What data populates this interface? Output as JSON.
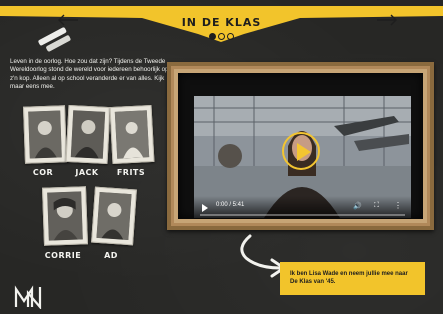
{
  "header": {
    "title": "IN DE KLAS",
    "page_indicator": {
      "total": 3,
      "current": 1
    }
  },
  "intro": {
    "text": "Leven in de oorlog. Hoe zou dat zijn? Tijdens de Tweede Wereldoorlog stond de wereld voor iedereen behoorlijk op z'n kop. Alleen al op school veranderde er van alles. Kijk maar eens mee."
  },
  "people": [
    {
      "name": "COR"
    },
    {
      "name": "JACK"
    },
    {
      "name": "FRITS"
    },
    {
      "name": "CORRIE"
    },
    {
      "name": "AD"
    }
  ],
  "video": {
    "time": "0:00 / 5:41",
    "progress": 0
  },
  "callout": {
    "text": "Ik ben Lisa Wade en neem jullie mee naar De Klas van '45."
  },
  "colors": {
    "accent": "#f2c42b",
    "background": "#272725",
    "frame": "#c7a576"
  },
  "icons": [
    "arrow-left-icon",
    "arrow-right-icon",
    "chalk-icon",
    "play-icon",
    "volume-icon",
    "fullscreen-icon",
    "more-icon",
    "logo-icon"
  ]
}
